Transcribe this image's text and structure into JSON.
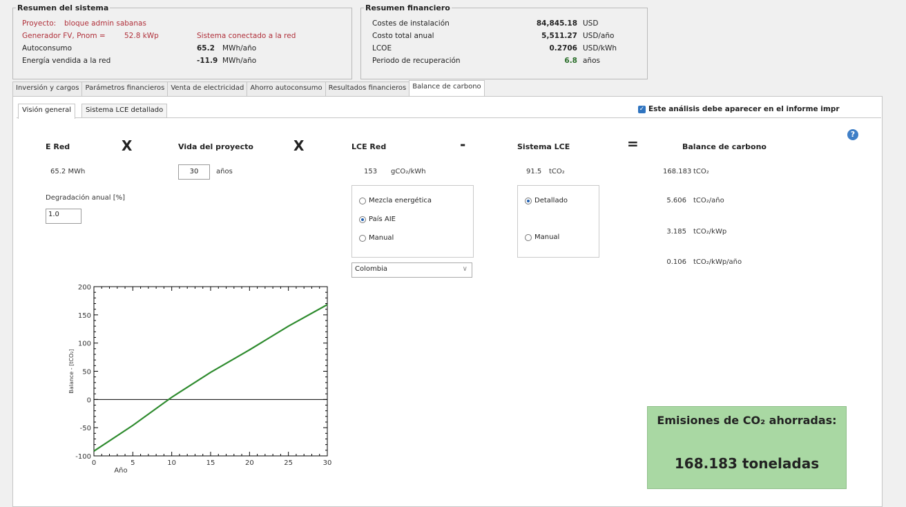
{
  "system_summary": {
    "title": "Resumen del sistema",
    "project_label": "Proyecto:",
    "project_value": "bloque admin sabanas",
    "generator_label": "Generador FV, Pnom =",
    "generator_value": "52.8 kWp",
    "grid_status": "Sistema conectado a la red",
    "selfconsumption_label": "Autoconsumo",
    "selfconsumption_value": "65.2",
    "selfconsumption_unit": "MWh/año",
    "sold_label": "Energía vendida a la red",
    "sold_value": "-11.9",
    "sold_unit": "MWh/año"
  },
  "financial_summary": {
    "title": "Resumen financiero",
    "rows": [
      {
        "label": "Costes de instalación",
        "value": "84,845.18",
        "unit": "USD"
      },
      {
        "label": "Costo total anual",
        "value": "5,511.27",
        "unit": "USD/año"
      },
      {
        "label": "LCOE",
        "value": "0.2706",
        "unit": "USD/kWh"
      },
      {
        "label": "Periodo de recuperación",
        "value": "6.8",
        "unit": "años"
      }
    ]
  },
  "tabs": [
    {
      "label": "Inversión y cargos"
    },
    {
      "label": "Parámetros financieros"
    },
    {
      "label": "Venta de electricidad"
    },
    {
      "label": "Ahorro autoconsumo"
    },
    {
      "label": "Resultados financieros"
    },
    {
      "label": "Balance de carbono"
    }
  ],
  "subtabs": [
    {
      "label": "Visión general"
    },
    {
      "label": "Sistema LCE detallado"
    }
  ],
  "report_checkbox_label": "Este análisis debe aparecer en el informe impr",
  "calc": {
    "ered_header": "E Red",
    "ered_value": "65.2  MWh",
    "op1": "X",
    "life_header": "Vida del proyecto",
    "life_value": "30",
    "life_unit": "años",
    "op2": "X",
    "lce_red_header": "LCE Red",
    "lce_red_value": "153",
    "lce_red_unit": "gCO₂/kWh",
    "op3": "-",
    "lce_sys_header": "Sistema LCE",
    "lce_sys_value": "91.5",
    "lce_sys_unit": "tCO₂",
    "op4": "=",
    "balance_header": "Balance de carbono",
    "degradation_label": "Degradación anual [%]",
    "degradation_value": "1.0",
    "grid_options": [
      "Mezcla energética",
      "País AIE",
      "Manual"
    ],
    "grid_selected": 1,
    "country_value": "Colombia",
    "lce_options": [
      "Detallado",
      "Manual"
    ],
    "lce_selected": 0,
    "balance_rows": [
      {
        "value": "168.183",
        "unit": "tCO₂"
      },
      {
        "value": "5.606",
        "unit": "tCO₂/año"
      },
      {
        "value": "3.185",
        "unit": "tCO₂/kWp"
      },
      {
        "value": "0.106",
        "unit": "tCO₂/kWp/año"
      }
    ]
  },
  "co2_saved": {
    "title": "Emisiones de CO₂ ahorradas:",
    "value": "168.183 toneladas"
  },
  "chart_data": {
    "type": "line",
    "xlabel": "Año",
    "ylabel": "Balance - [tCO₂]",
    "xlim": [
      0,
      30
    ],
    "ylim": [
      -100,
      200
    ],
    "xticks": [
      0,
      5,
      10,
      15,
      20,
      25,
      30
    ],
    "yticks": [
      -100,
      -50,
      0,
      50,
      100,
      150,
      200
    ],
    "series": [
      {
        "color": "#2e8b2e",
        "x": [
          0,
          5,
          10,
          15,
          20,
          25,
          30
        ],
        "y": [
          -91.5,
          -46,
          4,
          48,
          88,
          130,
          168.2
        ]
      }
    ]
  }
}
